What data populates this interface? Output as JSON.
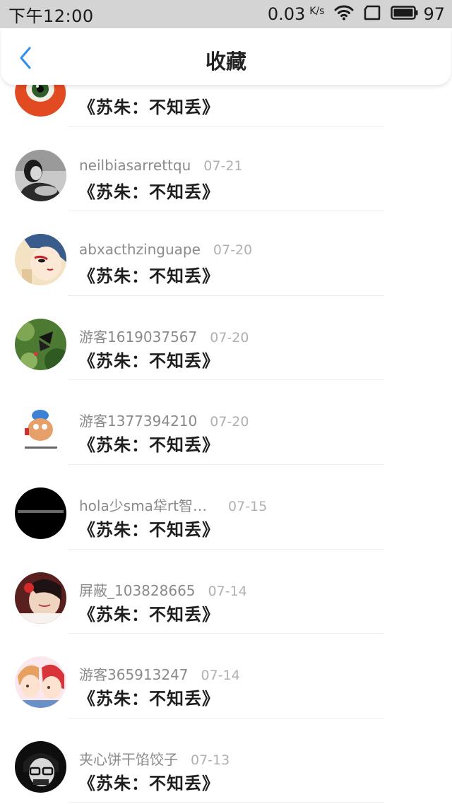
{
  "status_bar": {
    "time": "下午12:00",
    "net_speed": "0.03",
    "net_unit": "K/s",
    "battery_level": "97"
  },
  "header": {
    "title": "收藏"
  },
  "items": [
    {
      "username": "",
      "date": "",
      "title": "《苏朱：不知丢》"
    },
    {
      "username": "neilbiasarrettqu",
      "date": "07-21",
      "title": "《苏朱：不知丢》"
    },
    {
      "username": "abxacthzinguape",
      "date": "07-20",
      "title": "《苏朱：不知丢》"
    },
    {
      "username": "游客1619037567",
      "date": "07-20",
      "title": "《苏朱：不知丢》"
    },
    {
      "username": "游客1377394210",
      "date": "07-20",
      "title": "《苏朱：不知丢》"
    },
    {
      "username": "hola少sma牮rt智…",
      "date": "07-15",
      "title": "《苏朱：不知丢》"
    },
    {
      "username": "屏蔽_103828665",
      "date": "07-14",
      "title": "《苏朱：不知丢》"
    },
    {
      "username": "游客365913247",
      "date": "07-14",
      "title": "《苏朱：不知丢》"
    },
    {
      "username": "夹心饼干馅饺子",
      "date": "07-13",
      "title": "《苏朱：不知丢》"
    }
  ],
  "colors": {
    "accent": "#2f8ff0",
    "status_bar_bg": "#d4d4d4"
  },
  "icons": [
    "wifi-icon",
    "screen-icon",
    "battery-icon",
    "back-arrow-icon"
  ]
}
